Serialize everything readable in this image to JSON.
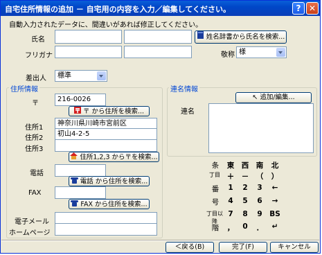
{
  "window": {
    "title": "自宅住所情報の追加 － 自宅用の内容を入力／編集してください。",
    "help": "?",
    "close": "✕"
  },
  "instruction": "自動入力されたデータに、間違いがあれば修正してください。",
  "name": {
    "label": "氏名",
    "last": "",
    "first": "",
    "lookup_button": "姓名辞書から氏名を検索..."
  },
  "furigana": {
    "label": "フリガナ",
    "last": "",
    "first": "",
    "honorific_label": "敬称",
    "honorific_value": "様"
  },
  "sender": {
    "label": "差出人",
    "value": "標準"
  },
  "address": {
    "group_title": "住所情報",
    "postal_label": "〒",
    "postal_value": "216-0026",
    "postal_button": "〒 から住所を検索...",
    "addr1_label": "住所1",
    "addr1_value": "神奈川県川崎市宮前区",
    "addr2_label": "住所2",
    "addr2_value": "初山4-2-5",
    "addr3_label": "住所3",
    "addr3_value": "",
    "addr_button": "住所1,2,3 から〒を検索...",
    "phone_label": "電話",
    "phone_value": "",
    "phone_button": "電話 から住所を検索...",
    "fax_label": "FAX",
    "fax_value": "",
    "fax_button": "FAX から住所を検索...",
    "email_label": "電子メール",
    "email_value": "",
    "homepage_label": "ホームページ",
    "homepage_value": ""
  },
  "joint": {
    "group_title": "連名情報",
    "add_button": "追加/編集...",
    "label": "連名"
  },
  "keypad": [
    [
      "条",
      "東",
      "西",
      "南",
      "北"
    ],
    [
      "丁目",
      "＋",
      "－",
      "（",
      "）"
    ],
    [
      "番",
      "1",
      "2",
      "3",
      "←"
    ],
    [
      "号",
      "4",
      "5",
      "6",
      "→"
    ],
    [
      "丁目以降",
      "7",
      "8",
      "9",
      "BS"
    ],
    [
      "階",
      "，",
      "0",
      "．",
      "↵"
    ]
  ],
  "footer": {
    "back": "＜戻る(B)",
    "finish": "完了(F)",
    "cancel": "キャンセル"
  },
  "colors": {
    "title_bar": "#0a5fd8",
    "group_title": "#0046d5"
  }
}
